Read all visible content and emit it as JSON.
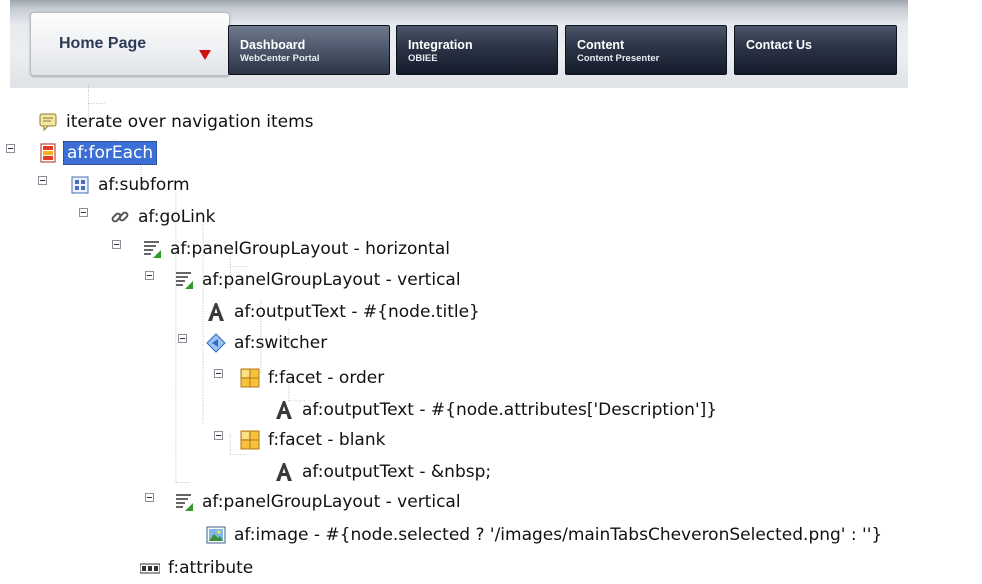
{
  "nav": {
    "home": "Home Page",
    "tabs": [
      {
        "title": "Dashboard",
        "sub": "WebCenter Portal"
      },
      {
        "title": "Integration",
        "sub": "OBIEE"
      },
      {
        "title": "Content",
        "sub": "Content Presenter"
      },
      {
        "title": "Contact Us",
        "sub": ""
      }
    ]
  },
  "tree": [
    {
      "label": "iterate over navigation items",
      "icon": "comment-icon",
      "level": 0,
      "expander": false
    },
    {
      "label": "af:forEach",
      "icon": "for-each-icon",
      "level": 0,
      "expander": true,
      "selected": true
    },
    {
      "label": "af:subform",
      "icon": "subform-icon",
      "level": 1,
      "expander": true
    },
    {
      "label": "af:goLink",
      "icon": "link-icon",
      "level": 2,
      "expander": true
    },
    {
      "label": "af:panelGroupLayout - horizontal",
      "icon": "panel-group-layout-icon",
      "level": 3,
      "expander": true
    },
    {
      "label": "af:panelGroupLayout - vertical",
      "icon": "panel-group-layout-icon",
      "level": 4,
      "expander": true
    },
    {
      "label": "af:outputText - #{node.title}",
      "icon": "output-text-icon",
      "level": 5,
      "expander": false
    },
    {
      "label": "af:switcher",
      "icon": "switcher-icon",
      "level": 5,
      "expander": true
    },
    {
      "label": "f:facet - order",
      "icon": "facet-icon",
      "level": 6,
      "expander": true
    },
    {
      "label": "af:outputText - #{node.attributes['Description']}",
      "icon": "output-text-icon",
      "level": 7,
      "expander": false
    },
    {
      "label": "f:facet - blank",
      "icon": "facet-icon",
      "level": 6,
      "expander": true
    },
    {
      "label": "af:outputText - &nbsp;",
      "icon": "output-text-icon",
      "level": 7,
      "expander": false
    },
    {
      "label": "af:panelGroupLayout - vertical",
      "icon": "panel-group-layout-icon",
      "level": 4,
      "expander": true
    },
    {
      "label": "af:image - #{node.selected ? '/images/mainTabsCheveronSelected.png' : ''}",
      "icon": "image-icon",
      "level": 5,
      "expander": false
    },
    {
      "label": "f:attribute",
      "icon": "attribute-icon",
      "level": 3,
      "expander": false
    }
  ]
}
